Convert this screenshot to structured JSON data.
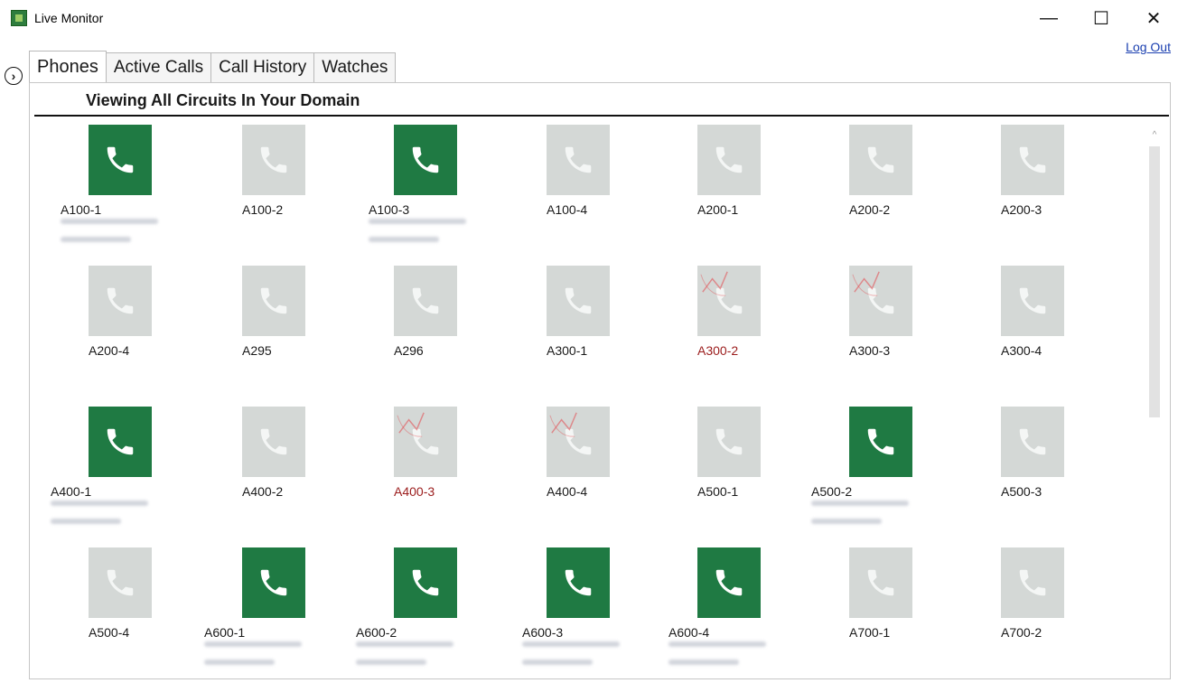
{
  "window": {
    "title": "Live Monitor",
    "minimize": "—",
    "maximize": "☐",
    "close": "✕"
  },
  "logout_label": "Log Out",
  "nav_toggle": "›",
  "tabs": [
    {
      "label": "Phones",
      "active": true
    },
    {
      "label": "Active Calls",
      "active": false
    },
    {
      "label": "Call History",
      "active": false
    },
    {
      "label": "Watches",
      "active": false
    }
  ],
  "heading": "Viewing All Circuits In Your Domain",
  "colors": {
    "active": "#1f7a43",
    "idle": "#d4d8d6",
    "flagged": "#9b1c1c"
  },
  "phones": [
    {
      "name": "A100-1",
      "status": "active",
      "obscured_info": true
    },
    {
      "name": "A100-2",
      "status": "idle"
    },
    {
      "name": "A100-3",
      "status": "active",
      "obscured_info": true
    },
    {
      "name": "A100-4",
      "status": "idle"
    },
    {
      "name": "A200-1",
      "status": "idle"
    },
    {
      "name": "A200-2",
      "status": "idle"
    },
    {
      "name": "A200-3",
      "status": "idle"
    },
    {
      "name": "A200-4",
      "status": "idle"
    },
    {
      "name": "A295",
      "status": "idle"
    },
    {
      "name": "A296",
      "status": "idle"
    },
    {
      "name": "A300-1",
      "status": "idle"
    },
    {
      "name": "A300-2",
      "status": "idle",
      "flagged": true
    },
    {
      "name": "A300-3",
      "status": "idle",
      "flagged": true
    },
    {
      "name": "A300-4",
      "status": "idle"
    },
    {
      "name": "A400-1",
      "status": "active",
      "obscured_info": true
    },
    {
      "name": "A400-2",
      "status": "idle"
    },
    {
      "name": "A400-3",
      "status": "idle",
      "flagged": true
    },
    {
      "name": "A400-4",
      "status": "idle",
      "flagged": true
    },
    {
      "name": "A500-1",
      "status": "idle"
    },
    {
      "name": "A500-2",
      "status": "active",
      "obscured_info": true
    },
    {
      "name": "A500-3",
      "status": "idle"
    },
    {
      "name": "A500-4",
      "status": "idle"
    },
    {
      "name": "A600-1",
      "status": "active",
      "obscured_info": true
    },
    {
      "name": "A600-2",
      "status": "active",
      "obscured_info": true
    },
    {
      "name": "A600-3",
      "status": "active",
      "obscured_info": true
    },
    {
      "name": "A600-4",
      "status": "active",
      "obscured_info": true
    },
    {
      "name": "A700-1",
      "status": "idle"
    },
    {
      "name": "A700-2",
      "status": "idle"
    }
  ]
}
